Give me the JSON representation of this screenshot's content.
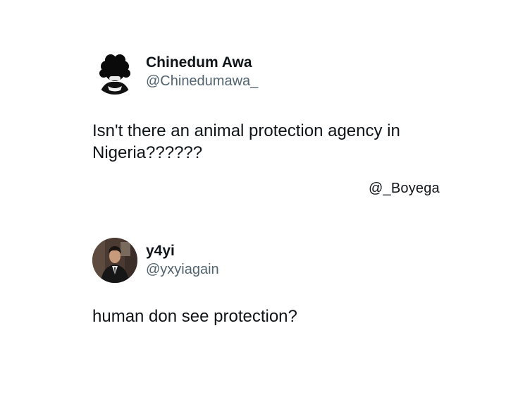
{
  "tweets": [
    {
      "display_name": "Chinedum Awa",
      "handle": "@Chinedumawa_",
      "text": "Isn't there an animal protection agency in Nigeria??????",
      "avatar_icon": "dark-haired-figure-avatar"
    },
    {
      "display_name": "y4yi",
      "handle": "@yxyiagain",
      "text": "human don see protection?",
      "avatar_icon": "man-in-suit-avatar"
    }
  ],
  "watermark": "@_Boyega",
  "colors": {
    "text_primary": "#0f1419",
    "text_secondary": "#536471",
    "background": "#ffffff"
  }
}
